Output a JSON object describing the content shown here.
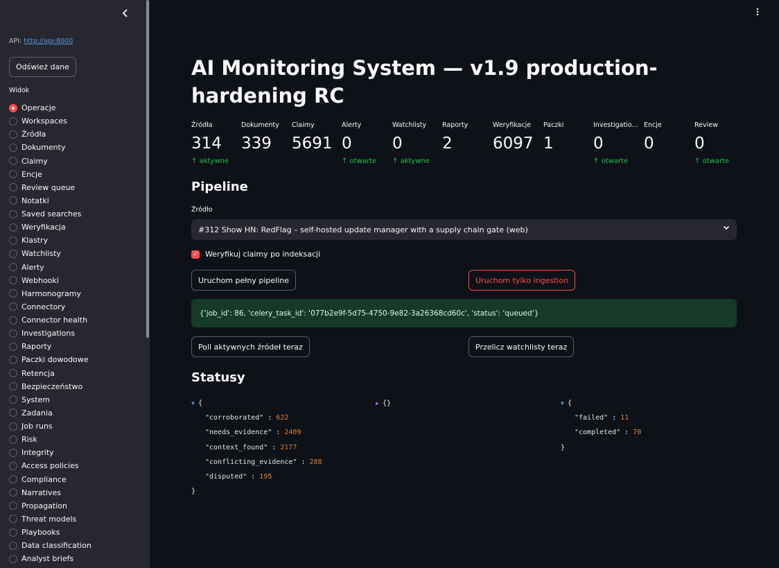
{
  "sidebar": {
    "api_label": "API:",
    "api_url": "http://api:8000",
    "refresh_label": "Odśwież dane",
    "view_label": "Widok",
    "items": [
      "Operacje",
      "Workspaces",
      "Źródła",
      "Dokumenty",
      "Claimy",
      "Encje",
      "Review queue",
      "Notatki",
      "Saved searches",
      "Weryfikacja",
      "Klastry",
      "Watchlisty",
      "Alerty",
      "Webhooki",
      "Harmonogramy",
      "Connectory",
      "Connector health",
      "Investigations",
      "Raporty",
      "Paczki dowodowe",
      "Retencja",
      "Bezpieczeństwo",
      "System",
      "Zadania",
      "Job runs",
      "Risk",
      "Integrity",
      "Access policies",
      "Compliance",
      "Narratives",
      "Propagation",
      "Threat models",
      "Playbooks",
      "Data classification",
      "Analyst briefs"
    ],
    "selected_index": 0
  },
  "main": {
    "title": "AI Monitoring System — v1.9 production-hardening RC",
    "metrics": [
      {
        "label": "Źródła",
        "value": "314",
        "delta": "aktywne"
      },
      {
        "label": "Dokumenty",
        "value": "339",
        "delta": ""
      },
      {
        "label": "Claimy",
        "value": "5691",
        "delta": ""
      },
      {
        "label": "Alerty",
        "value": "0",
        "delta": "otwarte"
      },
      {
        "label": "Watchlisty",
        "value": "0",
        "delta": "aktywne"
      },
      {
        "label": "Raporty",
        "value": "2",
        "delta": ""
      },
      {
        "label": "Weryfikacje",
        "value": "6097",
        "delta": ""
      },
      {
        "label": "Paczki",
        "value": "1",
        "delta": ""
      },
      {
        "label": "Investigations",
        "value": "0",
        "delta": "otwarte"
      },
      {
        "label": "Encje",
        "value": "0",
        "delta": ""
      },
      {
        "label": "Review",
        "value": "0",
        "delta": "otwarte"
      }
    ],
    "pipeline_heading": "Pipeline",
    "source_label": "Źródło",
    "source_selected": "#312 Show HN: RedFlag – self-hosted update manager with a supply chain gate (web)",
    "verify_checkbox_label": "Weryfikuj claimy po indeksacji",
    "run_full_label": "Uruchom pełny pipeline",
    "run_ingestion_label": "Uruchom tylko ingestion",
    "success_message": "{'job_id': 86, 'celery_task_id': '077b2e9f-5d75-4750-9e82-3a26368cd60c', 'status': 'queued'}",
    "poll_label": "Poll aktywnych źródeł teraz",
    "recalc_label": "Przelicz watchlisty teraz",
    "statusy_heading": "Statusy",
    "json1": [
      {
        "key": "\"corroborated\"",
        "value": "622"
      },
      {
        "key": "\"needs_evidence\"",
        "value": "2409"
      },
      {
        "key": "\"context_found\"",
        "value": "2177"
      },
      {
        "key": "\"conflicting_evidence\"",
        "value": "288"
      },
      {
        "key": "\"disputed\"",
        "value": "195"
      }
    ],
    "json2_collapsed": "{}",
    "json3": [
      {
        "key": "\"failed\"",
        "value": "11"
      },
      {
        "key": "\"completed\"",
        "value": "70"
      }
    ],
    "open_brace": "{",
    "close_brace": "}",
    "colon": " : "
  },
  "colors": {
    "accent": "#ff4b4b",
    "success": "#21c354",
    "sidebar_bg": "#262730",
    "main_bg": "#0e1117"
  },
  "icons": {
    "collapse": "chevron-left-icon",
    "menu": "vertical-dots-icon",
    "select": "chevron-down-icon",
    "delta": "arrow-up-icon"
  }
}
